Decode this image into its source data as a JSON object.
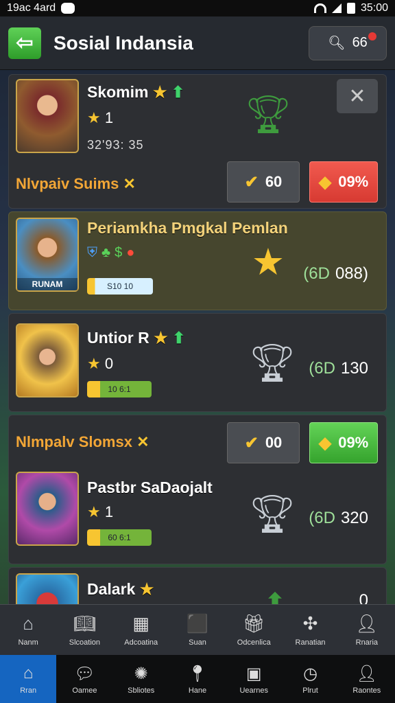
{
  "status_bar": {
    "left_text": "19ac 4ard",
    "time": "35:00"
  },
  "header": {
    "title": "Sosial Indansia",
    "search_count": "66"
  },
  "cards": [
    {
      "name": "Skomim",
      "level": "1",
      "meta": "32'93: 35",
      "tip": "Nlvpaiv Suims",
      "accept_label": "60",
      "boost_label": "09%",
      "icon": "green-trophy"
    },
    {
      "name": "Periamkha Pmgkal Pemlan",
      "avatar_label": "RUNAM",
      "progress_label": "S10 10",
      "score_prefix": "(6D",
      "score_value": "088)",
      "icon": "gold-star-trophy"
    },
    {
      "name": "Untior R",
      "level": "0",
      "progress_label": "10 6:1",
      "score_prefix": "(6D",
      "score_value": "130",
      "icon": "silver-trophy"
    },
    {
      "tip": "Nlmpalv Slomsx",
      "accept_label": "00",
      "boost_label": "09%"
    },
    {
      "name": "Pastbr SaDaojalt",
      "level": "1",
      "progress_label": "60 6:1",
      "score_prefix": "(6D",
      "score_value": "320",
      "icon": "silver-trophy"
    },
    {
      "name": "Dalark",
      "score_value": "0"
    }
  ],
  "bottom_nav": [
    {
      "label": "Nanm",
      "icon": "home-icon"
    },
    {
      "label": "Slcoation",
      "icon": "book-icon"
    },
    {
      "label": "Adcoatina",
      "icon": "calendar-icon"
    },
    {
      "label": "Suan",
      "icon": "box-icon"
    },
    {
      "label": "Odcenlica",
      "icon": "gift-icon"
    },
    {
      "label": "Ranatian",
      "icon": "network-icon"
    },
    {
      "label": "Rnaria",
      "icon": "person-icon"
    }
  ],
  "system_nav": [
    {
      "label": "Rran",
      "icon": "home-icon",
      "active": true
    },
    {
      "label": "Oamee",
      "icon": "chat-icon"
    },
    {
      "label": "Sbliotes",
      "icon": "wheel-icon"
    },
    {
      "label": "Hane",
      "icon": "pin-icon"
    },
    {
      "label": "Uearnes",
      "icon": "window-icon"
    },
    {
      "label": "Plrut",
      "icon": "clock-icon"
    },
    {
      "label": "Raontes",
      "icon": "person-icon"
    }
  ]
}
